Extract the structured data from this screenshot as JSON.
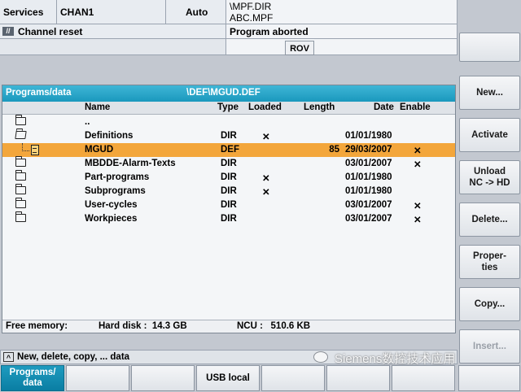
{
  "header": {
    "area": "Services",
    "channel": "CHAN1",
    "mode": "Auto",
    "program_path": "\\MPF.DIR",
    "program_name": "ABC.MPF",
    "channel_status": "Channel reset",
    "program_status": "Program aborted",
    "rov": "ROV"
  },
  "panel": {
    "title": "Programs/data",
    "path": "\\DEF\\MGUD.DEF",
    "columns": {
      "name": "Name",
      "type": "Type",
      "loaded": "Loaded",
      "length": "Length",
      "date": "Date",
      "enable": "Enable"
    },
    "rows": [
      {
        "icon": "folder-icon",
        "name": "..",
        "type": "",
        "loaded": "",
        "length": "",
        "date": "",
        "enable": ""
      },
      {
        "icon": "folder-open-icon",
        "name": "Definitions",
        "type": "DIR",
        "loaded": "✕",
        "length": "",
        "date": "01/01/1980",
        "enable": ""
      },
      {
        "icon": "file-icon",
        "name": "MGUD",
        "type": "DEF",
        "loaded": "",
        "length": "85",
        "date": "29/03/2007",
        "enable": "✕"
      },
      {
        "icon": "folder-icon",
        "name": "MBDDE-Alarm-Texts",
        "type": "DIR",
        "loaded": "",
        "length": "",
        "date": "03/01/2007",
        "enable": "✕"
      },
      {
        "icon": "folder-icon",
        "name": "Part-programs",
        "type": "DIR",
        "loaded": "✕",
        "length": "",
        "date": "01/01/1980",
        "enable": ""
      },
      {
        "icon": "folder-icon",
        "name": "Subprograms",
        "type": "DIR",
        "loaded": "✕",
        "length": "",
        "date": "01/01/1980",
        "enable": ""
      },
      {
        "icon": "folder-icon",
        "name": "User-cycles",
        "type": "DIR",
        "loaded": "",
        "length": "",
        "date": "03/01/2007",
        "enable": "✕"
      },
      {
        "icon": "folder-icon",
        "name": "Workpieces",
        "type": "DIR",
        "loaded": "",
        "length": "",
        "date": "03/01/2007",
        "enable": "✕"
      }
    ],
    "status": {
      "free_memory_label": "Free memory:",
      "hard_disk": "Hard disk :  14.3 GB",
      "ncu": "NCU :   510.6 KB"
    }
  },
  "footer": {
    "hint": "New, delete, copy, ... data",
    "watermark": "Siemens数控技术应用"
  },
  "softkeys_right": [
    {
      "label": "",
      "enabled": true
    },
    {
      "label": "New...",
      "enabled": true
    },
    {
      "label": "Activate",
      "enabled": true
    },
    {
      "label": "Unload\nNC -> HD",
      "enabled": true
    },
    {
      "label": "Delete...",
      "enabled": true
    },
    {
      "label": "Proper-\nties",
      "enabled": true
    },
    {
      "label": "Copy...",
      "enabled": true
    },
    {
      "label": "Insert...",
      "enabled": false
    }
  ],
  "softkeys_bottom": [
    {
      "label": "Programs/\ndata",
      "active": true
    },
    {
      "label": ""
    },
    {
      "label": ""
    },
    {
      "label": "USB local"
    },
    {
      "label": ""
    },
    {
      "label": ""
    },
    {
      "label": ""
    }
  ],
  "colors": {
    "accent": "#1a98bd",
    "selection": "#f3a63b",
    "background": "#c3c8d0"
  }
}
